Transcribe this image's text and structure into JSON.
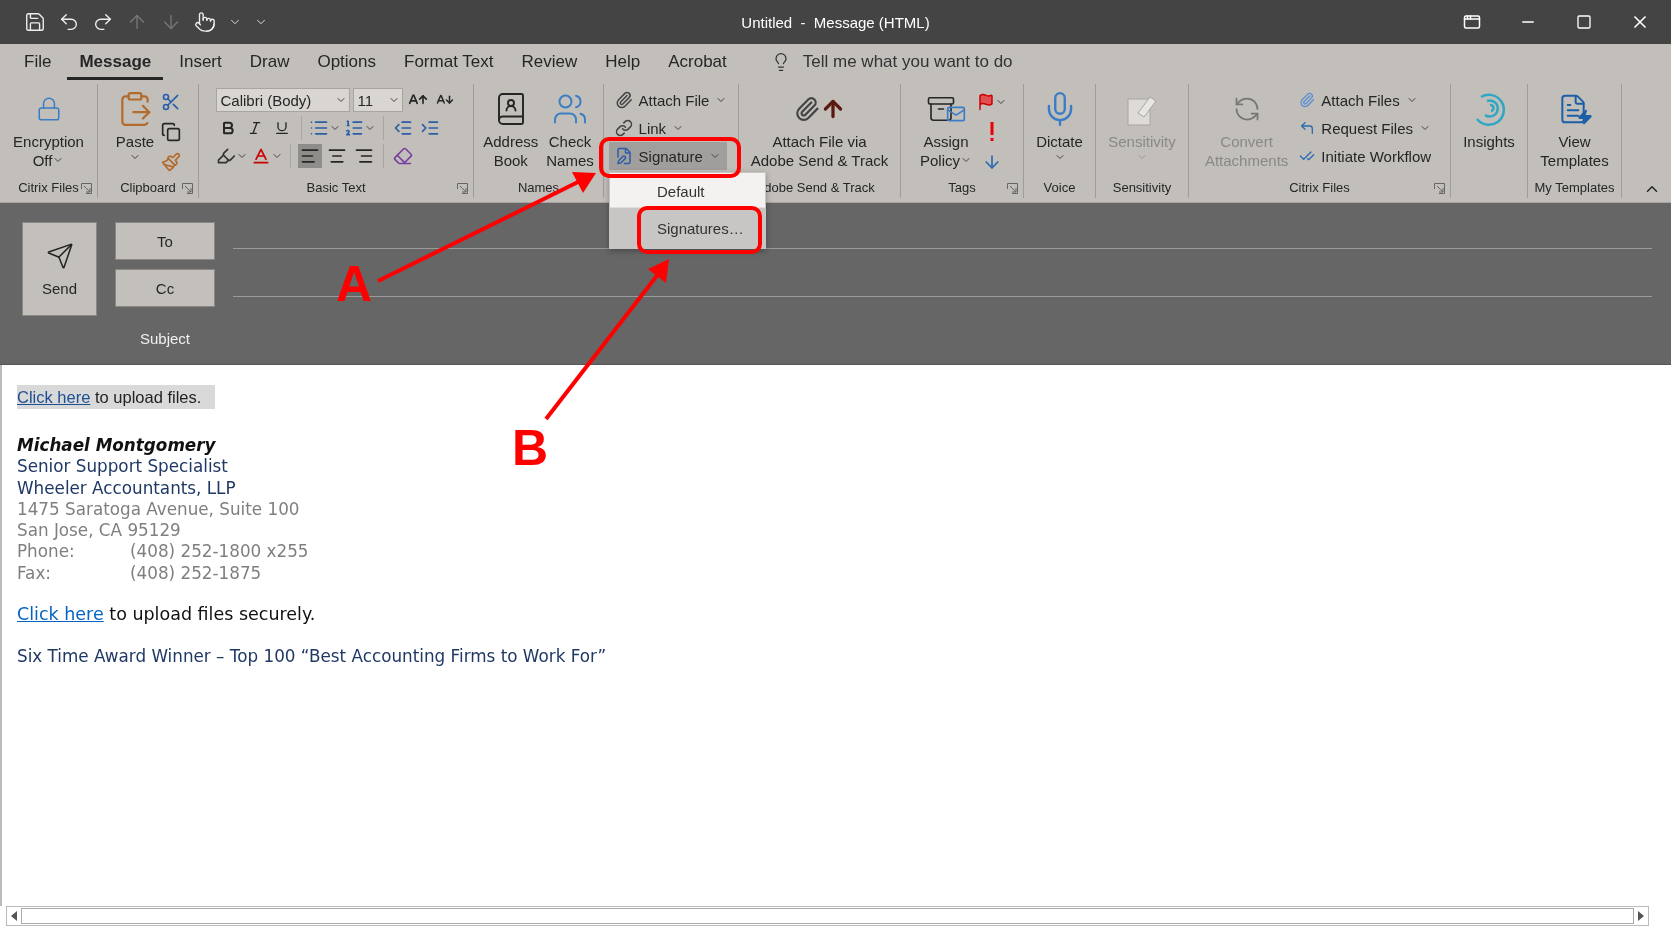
{
  "title_bar": {
    "title": "Untitled  -  Message (HTML)",
    "quick_access": [
      {
        "disabled": false
      },
      {
        "disabled": false
      },
      {
        "disabled": false
      },
      {
        "disabled": true
      },
      {
        "disabled": true
      },
      {
        "disabled": false
      },
      {
        "disabled": false
      },
      {
        "disabled": false
      }
    ]
  },
  "menu_tabs": [
    {
      "label": "File",
      "selected": false
    },
    {
      "label": "Message",
      "selected": true
    },
    {
      "label": "Insert",
      "selected": false
    },
    {
      "label": "Draw",
      "selected": false
    },
    {
      "label": "Options",
      "selected": false
    },
    {
      "label": "Format Text",
      "selected": false
    },
    {
      "label": "Review",
      "selected": false
    },
    {
      "label": "Help",
      "selected": false
    },
    {
      "label": "Acrobat",
      "selected": false
    }
  ],
  "tell_me": {
    "placeholder": "Tell me what you want to do"
  },
  "ribbon": [
    {
      "label": "Citrix Files",
      "launcher": true,
      "items": [
        {
          "kind": "large",
          "lines": [
            "Encryption",
            "Off"
          ],
          "dropdown": true,
          "disabled": false
        }
      ]
    },
    {
      "label": "Clipboard",
      "launcher": true,
      "items": [
        {
          "kind": "large",
          "lines": [
            "Paste"
          ],
          "dropdown": true,
          "disabled": false
        },
        {
          "kind": "tools"
        }
      ]
    },
    {
      "label": "Basic Text",
      "launcher": true,
      "items": [
        {
          "kind": "font",
          "font": "Calibri (Body)",
          "size": "11",
          "align": [
            {
              "selected": true
            },
            {
              "selected": false
            },
            {
              "selected": false
            }
          ]
        }
      ]
    },
    {
      "label": "Names",
      "items": [
        {
          "kind": "large",
          "lines": [
            "Address",
            "Book"
          ],
          "disabled": false
        },
        {
          "kind": "large",
          "lines": [
            "Check",
            "Names"
          ],
          "disabled": false
        }
      ]
    },
    {
      "items": [
        {
          "kind": "stack",
          "entries": [
            {
              "label": "Attach File",
              "dropdown": true,
              "expanded": false
            },
            {
              "label": "Link",
              "dropdown": true,
              "expanded": false
            },
            {
              "label": "Signature",
              "dropdown": true,
              "expanded": true
            }
          ]
        }
      ]
    },
    {
      "label": "dobe Send & Track",
      "items": [
        {
          "kind": "large",
          "lines": [
            "Attach File via",
            "Adobe Send & Track"
          ],
          "disabled": false
        }
      ]
    },
    {
      "label": "Tags",
      "launcher": true,
      "items": [
        {
          "kind": "large",
          "lines": [
            "Assign",
            "Policy"
          ],
          "dropdown": true,
          "disabled": false
        },
        {
          "kind": "tags"
        }
      ]
    },
    {
      "label": "Voice",
      "items": [
        {
          "kind": "large",
          "lines": [
            "Dictate"
          ],
          "dropdown": true,
          "disabled": false
        }
      ]
    },
    {
      "label": "Sensitivity",
      "items": [
        {
          "kind": "large",
          "lines": [
            "Sensitivity"
          ],
          "dropdown": true,
          "disabled": true
        }
      ]
    },
    {
      "label": "Citrix Files",
      "launcher": true,
      "items": [
        {
          "kind": "large",
          "lines": [
            "Convert",
            "Attachments"
          ],
          "disabled": true
        },
        {
          "kind": "stack",
          "entries": [
            {
              "label": "Attach Files",
              "dropdown": true,
              "expanded": false
            },
            {
              "label": "Request Files",
              "dropdown": true,
              "expanded": false
            },
            {
              "label": "Initiate Workflow",
              "dropdown": false,
              "expanded": false
            }
          ]
        }
      ]
    },
    {
      "items": [
        {
          "kind": "large",
          "lines": [
            "Insights"
          ],
          "disabled": false
        }
      ]
    },
    {
      "label": "My Templates",
      "items": [
        {
          "kind": "large",
          "lines": [
            "View",
            "Templates"
          ],
          "disabled": false
        }
      ]
    }
  ],
  "signature_menu": [
    {
      "label": "Default",
      "selected": false
    },
    {
      "label": "Signatures…",
      "selected": true
    }
  ],
  "compose": {
    "send": "Send",
    "to": "To",
    "cc": "Cc",
    "subject": "Subject"
  },
  "body": [
    {
      "kind": "note",
      "link": "Click here",
      "text": "to upload files."
    },
    {
      "kind": "name",
      "text": "Michael Montgomery"
    },
    {
      "kind": "title",
      "text": "Senior Support Specialist"
    },
    {
      "kind": "title",
      "text": "Wheeler Accountants, LLP"
    },
    {
      "kind": "address",
      "text": "1475 Saratoga Avenue, Suite 100"
    },
    {
      "kind": "address",
      "text": "San Jose, CA 95129"
    },
    {
      "kind": "contact",
      "label": "Phone:",
      "value": "(408) 252-1800 x255"
    },
    {
      "kind": "contact",
      "label": "Fax:",
      "value": "(408) 252-1875"
    },
    {
      "kind": "link_line",
      "link": "Click here",
      "text": "to upload files securely."
    },
    {
      "kind": "award",
      "text": "Six Time Award Winner – Top 100 “Best Accounting Firms to Work For”"
    }
  ],
  "annotations": [
    {
      "label": "A"
    },
    {
      "label": "B"
    }
  ]
}
